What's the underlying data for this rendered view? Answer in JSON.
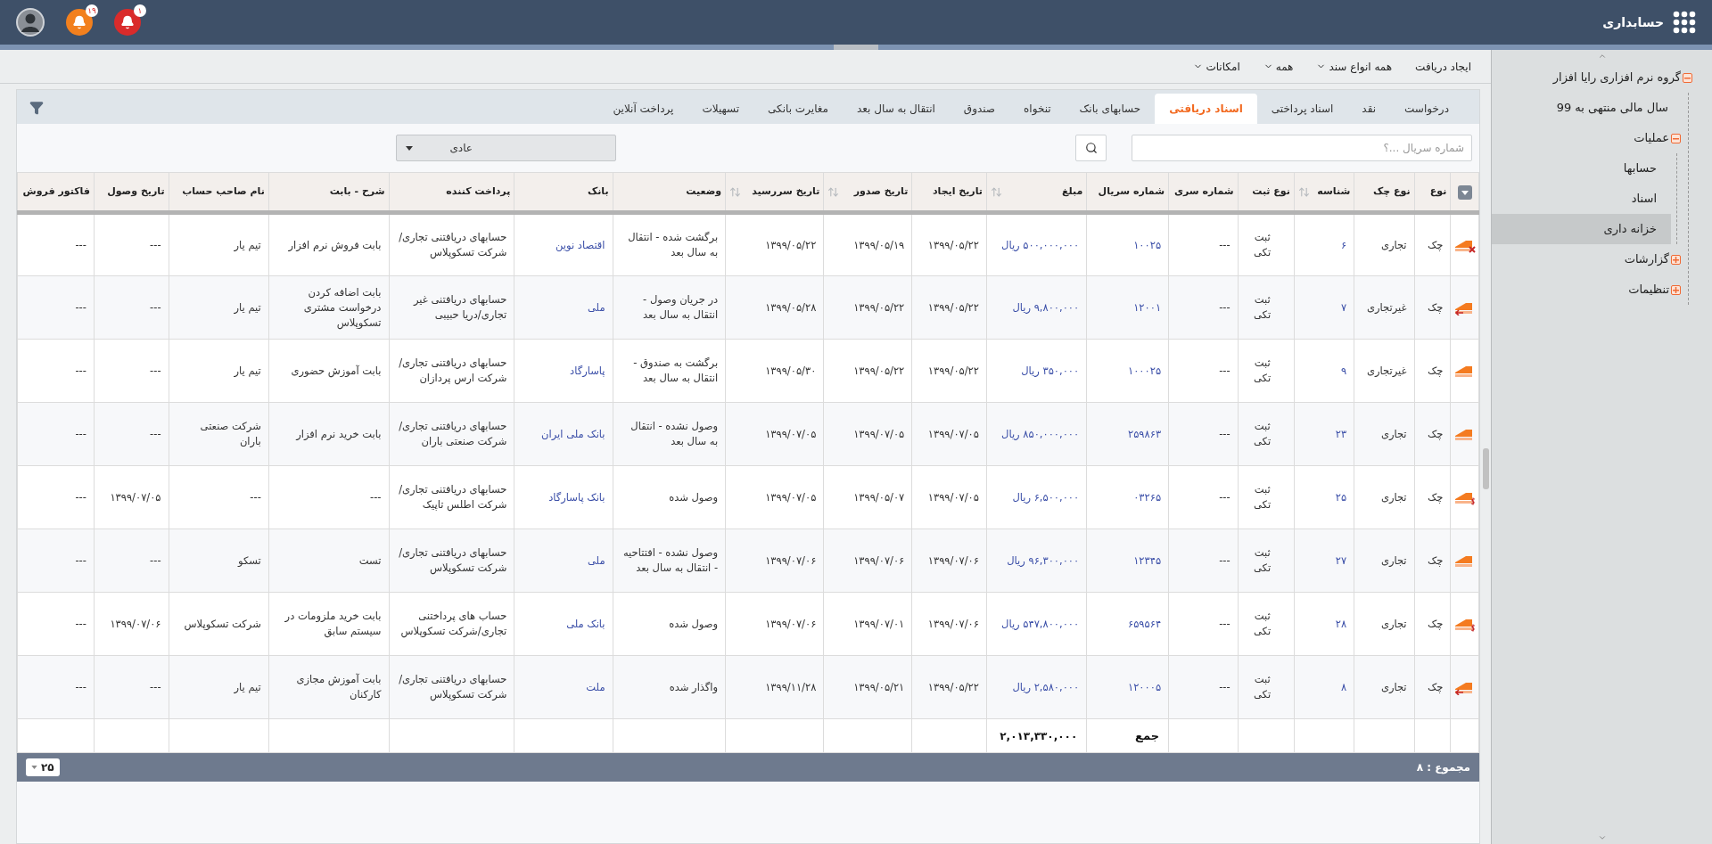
{
  "app": {
    "title": "حسابداری"
  },
  "header_icons": [
    {
      "kind": "alert",
      "badge": "۱"
    },
    {
      "kind": "notice",
      "badge": "۱۹"
    }
  ],
  "toolbar": [
    {
      "label": "ایجاد دریافت",
      "dropdown": false
    },
    {
      "label": "همه انواع سند",
      "dropdown": true
    },
    {
      "label": "همه",
      "dropdown": true
    },
    {
      "label": "امکانات",
      "dropdown": true
    }
  ],
  "tabs": [
    {
      "label": "درخواست",
      "selected": false
    },
    {
      "label": "نقد",
      "selected": false
    },
    {
      "label": "اسناد پرداختی",
      "selected": false
    },
    {
      "label": "اسناد دریافتی",
      "selected": true
    },
    {
      "label": "حسابهای بانک",
      "selected": false
    },
    {
      "label": "تنخواه",
      "selected": false
    },
    {
      "label": "صندوق",
      "selected": false
    },
    {
      "label": "انتقال به سال بعد",
      "selected": false
    },
    {
      "label": "مغایرت بانکی",
      "selected": false
    },
    {
      "label": "تسهیلات",
      "selected": false
    },
    {
      "label": "پرداخت آنلاین",
      "selected": false
    }
  ],
  "search": {
    "placeholder": "شماره سریال ...؟"
  },
  "filter_select": {
    "value": "عادی"
  },
  "table": {
    "columns": [
      {
        "title": "نوع",
        "kind": "text",
        "sortable": false
      },
      {
        "title": "نوع چک",
        "kind": "text",
        "sortable": false
      },
      {
        "title": "شناسه",
        "kind": "link",
        "sortable": true
      },
      {
        "title": "نوع ثبت",
        "kind": "text",
        "sortable": false
      },
      {
        "title": "شماره سری",
        "kind": "text",
        "sortable": false
      },
      {
        "title": "شماره سریال",
        "kind": "link",
        "sortable": false
      },
      {
        "title": "مبلغ",
        "kind": "link",
        "sortable": true
      },
      {
        "title": "تاریخ ایجاد",
        "kind": "text",
        "sortable": false
      },
      {
        "title": "تاریخ صدور",
        "kind": "text",
        "sortable": true
      },
      {
        "title": "تاریخ سررسید",
        "kind": "text",
        "sortable": true
      },
      {
        "title": "وضعیت",
        "kind": "text",
        "sortable": false
      },
      {
        "title": "بانک",
        "kind": "link",
        "sortable": false
      },
      {
        "title": "پرداخت کننده",
        "kind": "text",
        "sortable": false
      },
      {
        "title": "شرح - بابت",
        "kind": "text",
        "sortable": false
      },
      {
        "title": "نام صاحب حساب",
        "kind": "text",
        "sortable": false
      },
      {
        "title": "تاریخ وصول",
        "kind": "text",
        "sortable": false
      },
      {
        "title": "فاکتور فروش",
        "kind": "text",
        "sortable": false
      }
    ],
    "rows": [
      {
        "kind": "cross",
        "cells": [
          "چک",
          "تجاری",
          "۶",
          "ثبت تکی",
          "---",
          "۱۰۰۲۵",
          "۵۰۰,۰۰۰,۰۰۰ ریال",
          "۱۳۹۹/۰۵/۲۲",
          "۱۳۹۹/۰۵/۱۹",
          "۱۳۹۹/۰۵/۲۲",
          "برگشت شده - انتقال به سال بعد",
          "اقتصاد نوین",
          "حسابهای دریافتنی تجاری/شرکت تسکوپلاس",
          "بابت فروش نرم افزار",
          "تیم یار",
          "---",
          "---"
        ]
      },
      {
        "kind": "arrow",
        "cells": [
          "چک",
          "غیرتجاری",
          "۷",
          "ثبت تکی",
          "---",
          "۱۲۰۰۱",
          "۹,۸۰۰,۰۰۰ ریال",
          "۱۳۹۹/۰۵/۲۲",
          "۱۳۹۹/۰۵/۲۲",
          "۱۳۹۹/۰۵/۲۸",
          "در جریان وصول - انتقال به سال بعد",
          "ملی",
          "حسابهای دریافتنی غیر تجاری/دریا حبیبی",
          "بابت اضافه کردن درخواست مشتری تسکوپلاس",
          "تیم یار",
          "---",
          "---"
        ]
      },
      {
        "kind": "plain",
        "cells": [
          "چک",
          "غیرتجاری",
          "۹",
          "ثبت تکی",
          "---",
          "۱۰۰۰۲۵",
          "۳۵۰,۰۰۰ ریال",
          "۱۳۹۹/۰۵/۲۲",
          "۱۳۹۹/۰۵/۲۲",
          "۱۳۹۹/۰۵/۳۰",
          "برگشت به صندوق - انتقال به سال بعد",
          "پاسارگاد",
          "حسابهای دریافتنی تجاری/شرکت ارس پردازان",
          "بابت آموزش حضوری",
          "تیم یار",
          "---",
          "---"
        ]
      },
      {
        "kind": "plain",
        "cells": [
          "چک",
          "تجاری",
          "۲۳",
          "ثبت تکی",
          "---",
          "۲۵۹۸۶۳",
          "۸۵۰,۰۰۰,۰۰۰ ریال",
          "۱۳۹۹/۰۷/۰۵",
          "۱۳۹۹/۰۷/۰۵",
          "۱۳۹۹/۰۷/۰۵",
          "وصول نشده - انتقال به سال بعد",
          "بانک ملی ایران",
          "حسابهای دریافتنی تجاری/شرکت صنعتی باران",
          "بابت خرید نرم افزار",
          "شرکت صنعتی باران",
          "---",
          "---"
        ]
      },
      {
        "kind": "dollar",
        "cells": [
          "چک",
          "تجاری",
          "۲۵",
          "ثبت تکی",
          "---",
          "۰۳۲۶۵",
          "۶,۵۰۰,۰۰۰ ریال",
          "۱۳۹۹/۰۷/۰۵",
          "۱۳۹۹/۰۵/۰۷",
          "۱۳۹۹/۰۷/۰۵",
          "وصول شده",
          "بانک پاسارگاد",
          "حسابهای دریافتنی تجاری/شرکت اطلس تاپیک",
          "---",
          "---",
          "۱۳۹۹/۰۷/۰۵",
          "---"
        ]
      },
      {
        "kind": "plain",
        "cells": [
          "چک",
          "تجاری",
          "۲۷",
          "ثبت تکی",
          "---",
          "۱۲۳۴۵",
          "۹۶,۳۰۰,۰۰۰ ریال",
          "۱۳۹۹/۰۷/۰۶",
          "۱۳۹۹/۰۷/۰۶",
          "۱۳۹۹/۰۷/۰۶",
          "وصول نشده - افتتاحیه - انتقال به سال بعد",
          "ملی",
          "حسابهای دریافتنی تجاری/شرکت تسکوپلاس",
          "تست",
          "تسکو",
          "---",
          "---"
        ]
      },
      {
        "kind": "dollar",
        "cells": [
          "چک",
          "تجاری",
          "۲۸",
          "ثبت تکی",
          "---",
          "۶۵۹۵۶۴",
          "۵۴۷,۸۰۰,۰۰۰ ریال",
          "۱۳۹۹/۰۷/۰۶",
          "۱۳۹۹/۰۷/۰۱",
          "۱۳۹۹/۰۷/۰۶",
          "وصول شده",
          "بانک ملی",
          "حساب های پرداختنی تجاری/شرکت تسکوپلاس",
          "بابت خرید ملزومات در سیستم سابق",
          "شرکت تسکوپلاس",
          "۱۳۹۹/۰۷/۰۶",
          "---"
        ]
      },
      {
        "kind": "arrow",
        "cells": [
          "چک",
          "تجاری",
          "۸",
          "ثبت تکی",
          "---",
          "۱۲۰۰۰۵",
          "۲,۵۸۰,۰۰۰ ریال",
          "۱۳۹۹/۰۵/۲۲",
          "۱۳۹۹/۰۵/۲۱",
          "۱۳۹۹/۱۱/۲۸",
          "واگذار شده",
          "ملت",
          "حسابهای دریافتنی تجاری/شرکت تسکوپلاس",
          "بابت آموزش مجازی کارکنان",
          "تیم یار",
          "---",
          "---"
        ]
      }
    ],
    "total": {
      "label": "جمع",
      "amount": "۲,۰۱۳,۳۳۰,۰۰۰"
    }
  },
  "footer": {
    "count": "مجموع : ۸",
    "page_size": "۲۵"
  },
  "sidebar": {
    "tree": [
      {
        "label": "گروه نرم افزاری رایا افزار",
        "selected": false,
        "expanded": true,
        "children": [
          {
            "label": "سال مالی منتهی به 99",
            "selected": false
          },
          {
            "label": "عملیات",
            "selected": false,
            "expanded": true,
            "children": [
              {
                "label": "حسابها",
                "selected": false
              },
              {
                "label": "اسناد",
                "selected": false
              },
              {
                "label": "خزانه داری",
                "selected": true
              }
            ]
          },
          {
            "label": "گزارشات",
            "selected": false,
            "expanded": false
          },
          {
            "label": "تنظیمات",
            "selected": false,
            "expanded": false
          }
        ]
      }
    ]
  }
}
